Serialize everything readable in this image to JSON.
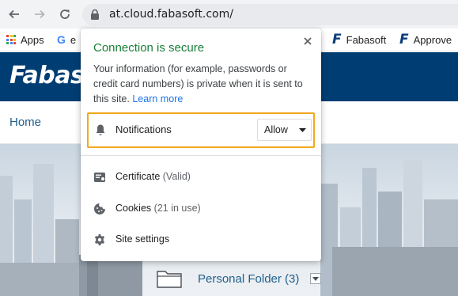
{
  "browser": {
    "url": "at.cloud.fabasoft.com/",
    "bookmarks": [
      {
        "label": "Apps"
      },
      {
        "label": "e"
      },
      {
        "label": "Fabasoft"
      },
      {
        "label": "Approve"
      }
    ]
  },
  "site": {
    "logo": "Fabasoft",
    "nav_home": "Home",
    "folder_label": "Personal Folder (3)"
  },
  "popup": {
    "title": "Connection is secure",
    "description": "Your information (for example, passwords or credit card numbers) is private when it is sent to this site.",
    "learn_more": "Learn more",
    "notifications_label": "Notifications",
    "notifications_value": "Allow",
    "certificate_label": "Certificate",
    "certificate_status": "(Valid)",
    "cookies_label": "Cookies",
    "cookies_status": "(21 in use)",
    "site_settings_label": "Site settings"
  },
  "colors": {
    "secure_green": "#188038",
    "link_blue": "#1a73e8",
    "highlight_orange": "#f2a81d",
    "site_header_blue": "#003d73"
  },
  "icons": [
    "back-arrow-icon",
    "forward-arrow-icon",
    "reload-icon",
    "lock-icon",
    "apps-grid-icon",
    "google-g-icon",
    "fabasoft-f-icon",
    "close-icon",
    "bell-icon",
    "chevron-down-icon",
    "certificate-icon",
    "cookie-icon",
    "gear-icon",
    "folder-icon"
  ]
}
